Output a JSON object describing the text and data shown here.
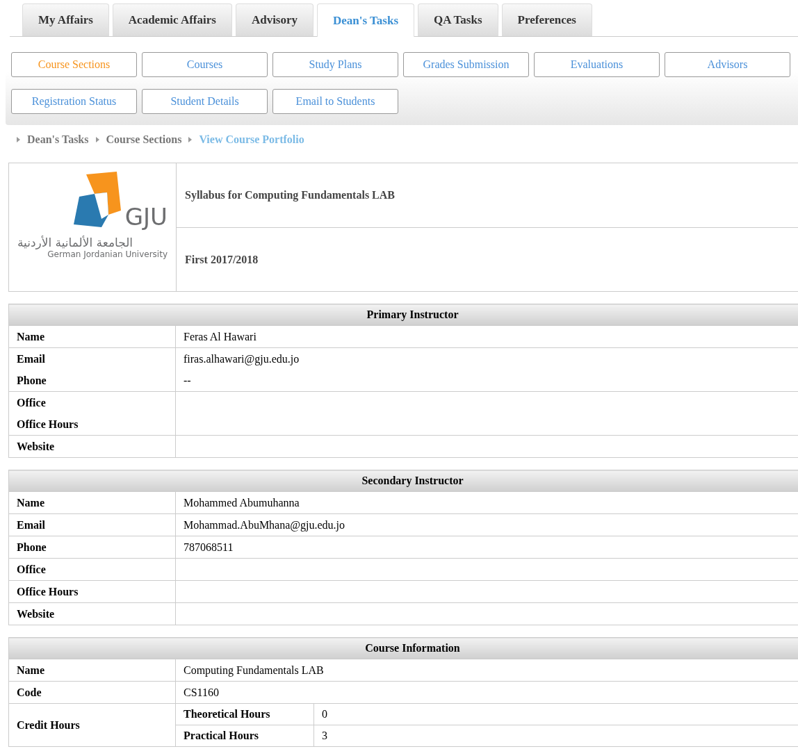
{
  "tabs": [
    {
      "label": "My Affairs",
      "selected": false
    },
    {
      "label": "Academic Affairs",
      "selected": false
    },
    {
      "label": "Advisory",
      "selected": false
    },
    {
      "label": "Dean's Tasks",
      "selected": true
    },
    {
      "label": "QA Tasks",
      "selected": false
    },
    {
      "label": "Preferences",
      "selected": false
    }
  ],
  "subnav": [
    {
      "label": "Course Sections",
      "selected": true
    },
    {
      "label": "Courses",
      "selected": false
    },
    {
      "label": "Study Plans",
      "selected": false
    },
    {
      "label": "Grades Submission",
      "selected": false
    },
    {
      "label": "Evaluations",
      "selected": false
    },
    {
      "label": "Advisors",
      "selected": false
    },
    {
      "label": "Registration Status",
      "selected": false
    },
    {
      "label": "Student Details",
      "selected": false
    },
    {
      "label": "Email to Students",
      "selected": false
    }
  ],
  "breadcrumb": [
    {
      "label": "Dean's Tasks",
      "selected": false
    },
    {
      "label": "Course Sections",
      "selected": false
    },
    {
      "label": "View Course Portfolio",
      "selected": true
    }
  ],
  "header": {
    "logo": {
      "mark": "GJU",
      "arabic": "الجامعة الألمانية الأردنية",
      "english": "German Jordanian University"
    },
    "title": "Syllabus for Computing Fundamentals LAB",
    "semester": "First 2017/2018"
  },
  "sections": [
    {
      "title": "Primary Instructor",
      "rows": [
        {
          "fields": [
            {
              "label": "Name",
              "value": "Feras Al Hawari"
            }
          ]
        },
        {
          "fields": [
            {
              "label": "Email",
              "value": "firas.alhawari@gju.edu.jo"
            },
            {
              "label": "Phone",
              "value": "--"
            }
          ]
        },
        {
          "fields": [
            {
              "label": "Office"
            },
            {
              "label": "Office Hours"
            }
          ]
        },
        {
          "fields": [
            {
              "label": "Website"
            }
          ]
        }
      ]
    },
    {
      "title": "Secondary Instructor",
      "rows": [
        {
          "fields": [
            {
              "label": "Name",
              "value": "Mohammed Abumuhanna"
            }
          ]
        },
        {
          "fields": [
            {
              "label": "Email",
              "value": "Mohammad.AbuMhana@gju.edu.jo"
            }
          ]
        },
        {
          "fields": [
            {
              "label": "Phone",
              "value": "787068511"
            }
          ]
        },
        {
          "fields": [
            {
              "label": "Office"
            }
          ]
        },
        {
          "fields": [
            {
              "label": "Office Hours"
            }
          ]
        },
        {
          "fields": [
            {
              "label": "Website"
            }
          ]
        }
      ]
    },
    {
      "title": "Course Information",
      "rows": [
        {
          "fields": [
            {
              "label": "Name",
              "value": "Computing Fundamentals LAB"
            }
          ]
        },
        {
          "fields": [
            {
              "label": "Code",
              "value": "CS1160"
            }
          ]
        },
        {
          "label": "Credit Hours",
          "sub": [
            {
              "label": "Theoretical Hours",
              "value": "0"
            },
            {
              "label": "Practical Hours",
              "value": "3"
            }
          ]
        }
      ]
    }
  ]
}
